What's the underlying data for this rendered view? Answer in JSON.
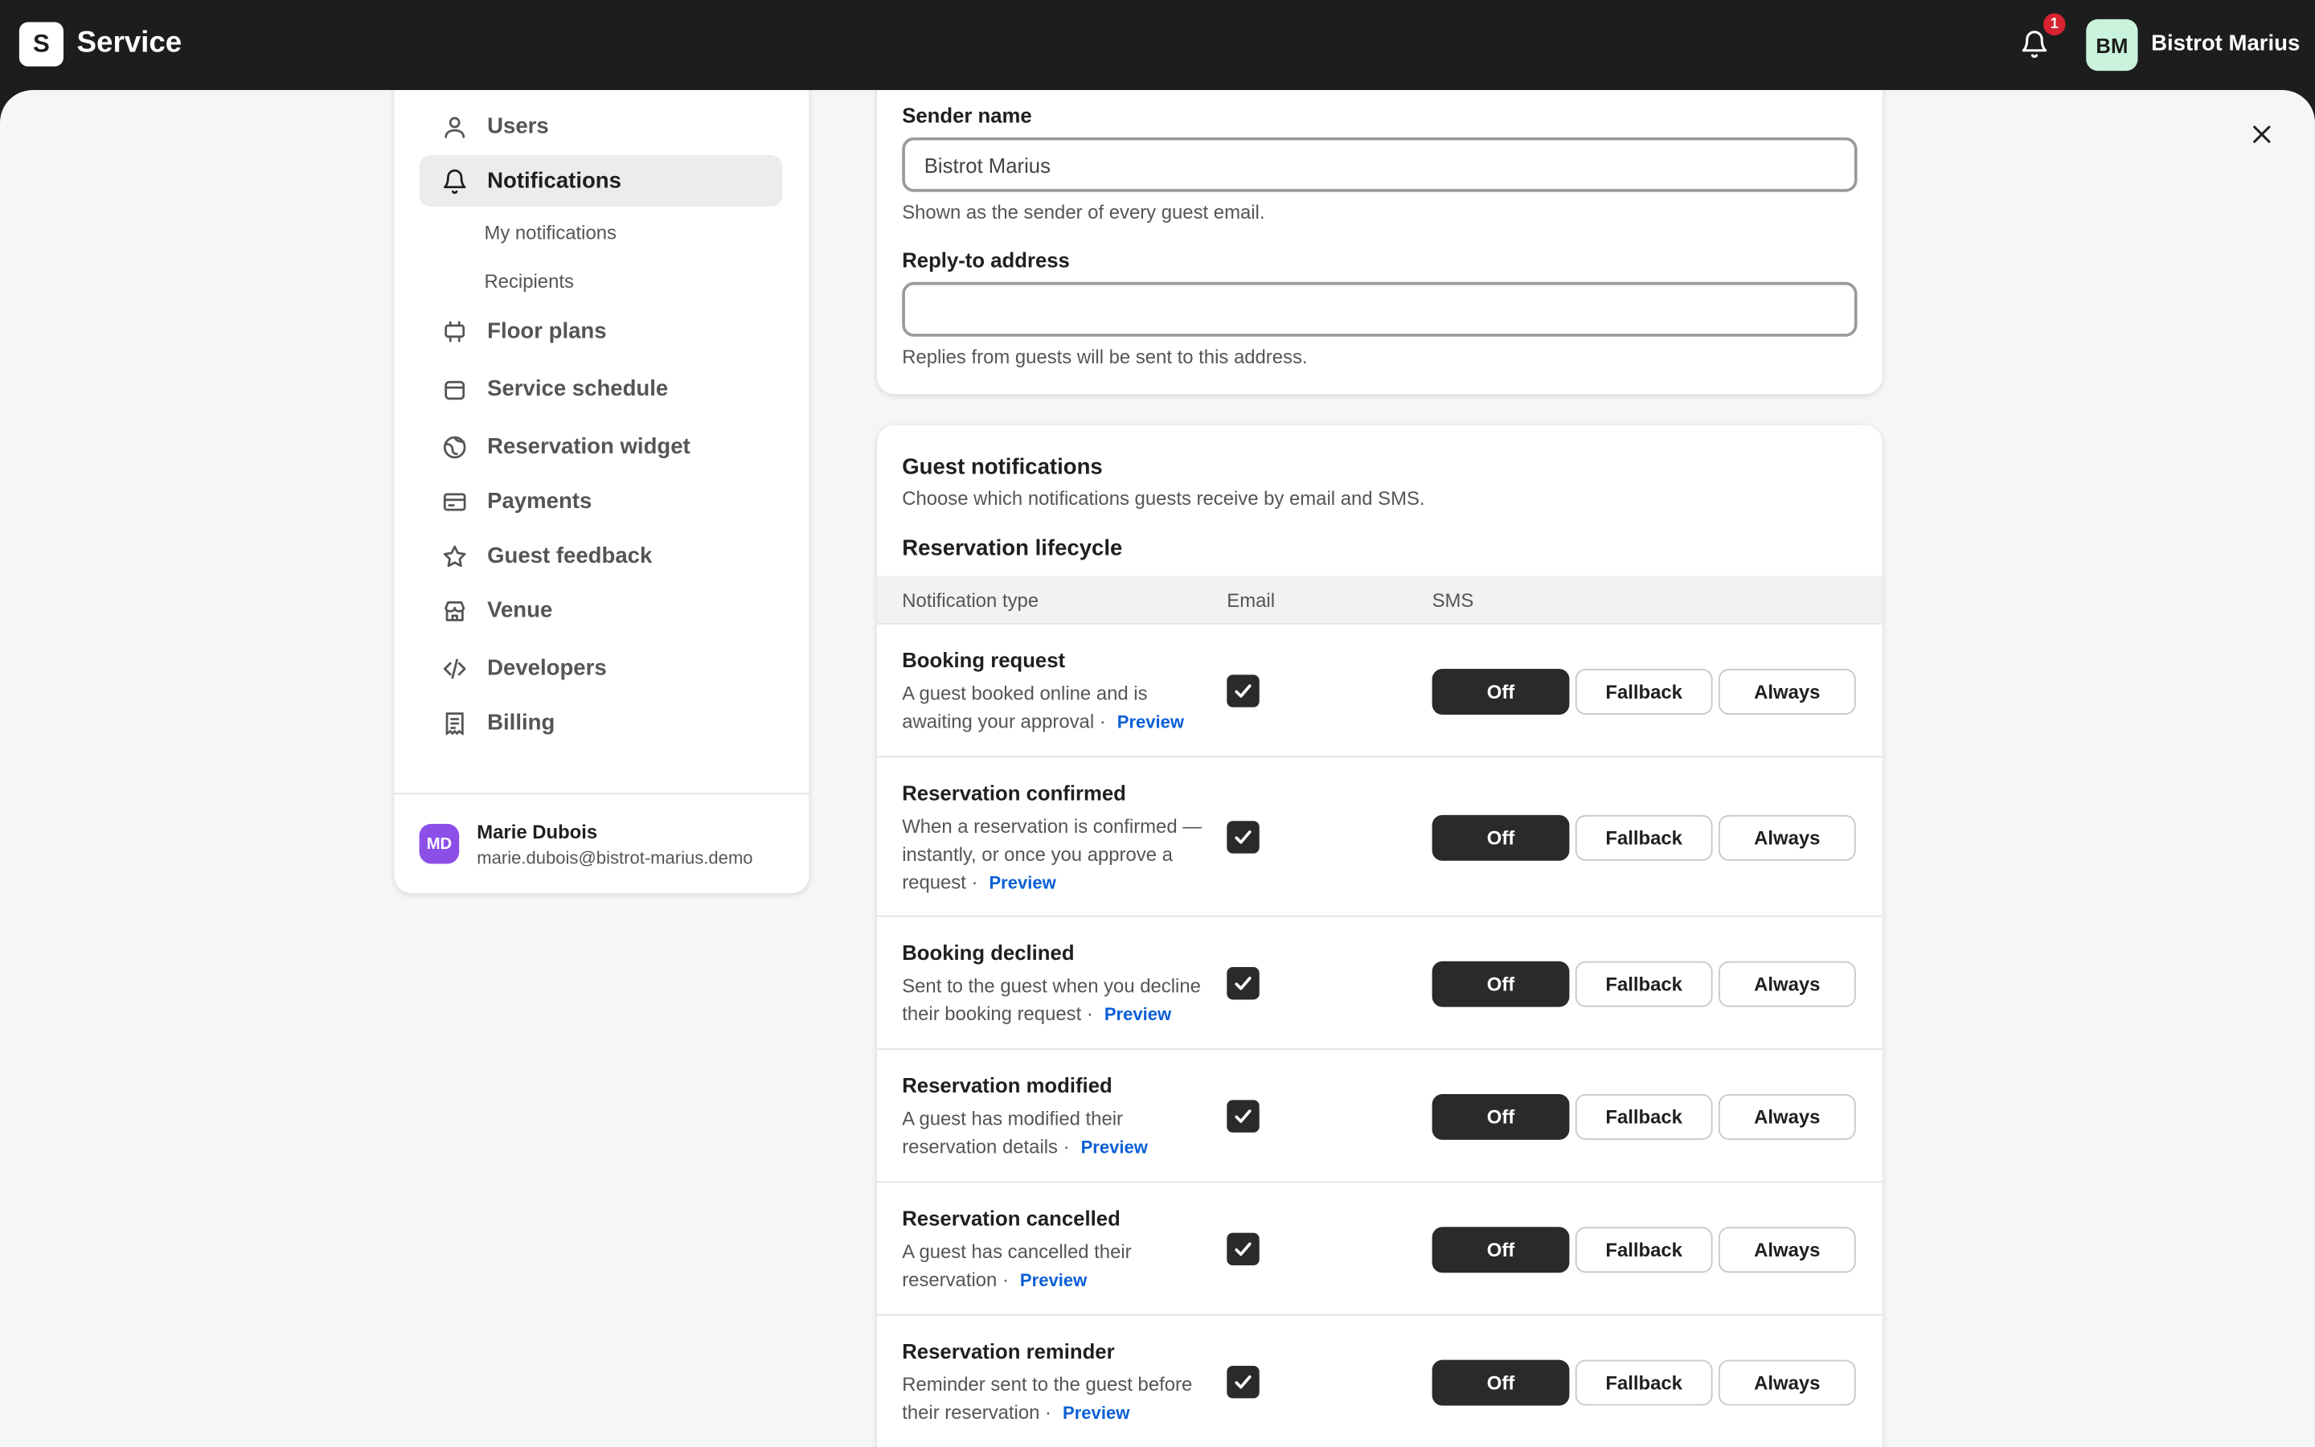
{
  "topbar": {
    "logo_letter": "S",
    "app_title": "Service",
    "notification_count": "1",
    "avatar_initials": "BM",
    "username": "Bistrot Marius"
  },
  "sidebar": {
    "items": [
      {
        "label": "Users",
        "icon": "user-icon"
      },
      {
        "label": "Notifications",
        "icon": "bell-icon",
        "active": true
      },
      {
        "label": "Floor plans",
        "icon": "floor-plan-icon"
      },
      {
        "label": "Service schedule",
        "icon": "calendar-icon"
      },
      {
        "label": "Reservation widget",
        "icon": "globe-icon"
      },
      {
        "label": "Payments",
        "icon": "credit-card-icon"
      },
      {
        "label": "Guest feedback",
        "icon": "star-icon"
      },
      {
        "label": "Venue",
        "icon": "store-icon"
      },
      {
        "label": "Developers",
        "icon": "code-icon"
      },
      {
        "label": "Billing",
        "icon": "receipt-icon"
      }
    ],
    "sub_items": [
      "My notifications",
      "Recipients"
    ],
    "user": {
      "initials": "MD",
      "name": "Marie Dubois",
      "email": "marie.dubois@bistrot-marius.demo"
    }
  },
  "sender": {
    "sender_name_label": "Sender name",
    "sender_name_value": "Bistrot Marius",
    "sender_name_help": "Shown as the sender of every guest email.",
    "reply_to_label": "Reply-to address",
    "reply_to_value": "",
    "reply_to_help": "Replies from guests will be sent to this address."
  },
  "guest": {
    "title": "Guest notifications",
    "subtitle": "Choose which notifications guests receive by email and SMS.",
    "section": "Reservation lifecycle",
    "columns": [
      "Notification type",
      "Email",
      "SMS"
    ],
    "preview_label": "Preview",
    "sms_options": [
      "Off",
      "Fallback",
      "Always"
    ],
    "rows": [
      {
        "title": "Booking request",
        "desc": "A guest booked online and is awaiting your approval ·",
        "email": true,
        "sms": "Off"
      },
      {
        "title": "Reservation confirmed",
        "desc": "When a reservation is confirmed — instantly, or once you approve a request ·",
        "email": true,
        "sms": "Off"
      },
      {
        "title": "Booking declined",
        "desc": "Sent to the guest when you decline their booking request ·",
        "email": true,
        "sms": "Off"
      },
      {
        "title": "Reservation modified",
        "desc": "A guest has modified their reservation details ·",
        "email": true,
        "sms": "Off"
      },
      {
        "title": "Reservation cancelled",
        "desc": "A guest has cancelled their reservation ·",
        "email": true,
        "sms": "Off"
      },
      {
        "title": "Reservation reminder",
        "desc": "Reminder sent to the guest before their reservation ·",
        "email": true,
        "sms": "Off"
      }
    ]
  }
}
